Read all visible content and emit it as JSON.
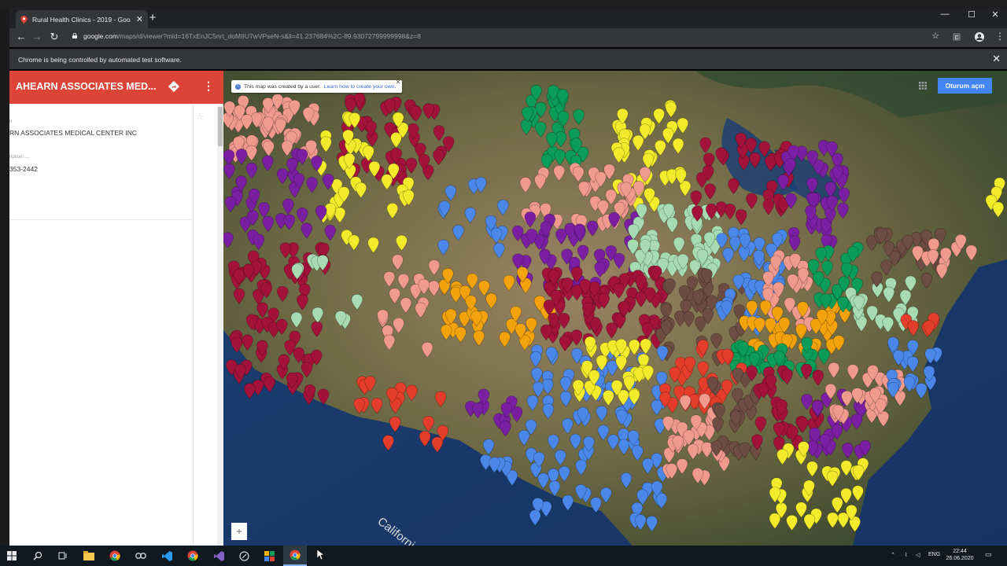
{
  "browser": {
    "tab_title": "Rural Health Clinics - 2019 - Goo",
    "url_host": "google.com",
    "url_path": "/maps/d/viewer?mid=16TxEnJC5nrt_doMIIU7wVPseN-s&ll=41.237684%2C-89.93072799999998&z=8",
    "infobar_message": "Chrome is being controlled by automated test software.",
    "new_tab_label": "+"
  },
  "sidepanel": {
    "title": "AHEARN ASSOCIATES MED...",
    "field1_label": "n",
    "field1_value": "RN ASSOCIATES MEDICAL CENTER INC",
    "field2_label": "ription:.....",
    "field2_value": "353-2442"
  },
  "map": {
    "notice_text": "This map was created by a user.",
    "notice_link": "Learn how to create your own.",
    "signin_label": "Oturum açın",
    "zoom_in": "+",
    "place_label": "California",
    "marker_colors": {
      "crimson": "#a3123a",
      "salmon": "#f09a8e",
      "yellow": "#f2ea2a",
      "green": "#0b9d58",
      "purple": "#7b1fa2",
      "blue": "#4a87e8",
      "mint": "#a7dcb2",
      "brown": "#6d4c41",
      "orange": "#f2a20d",
      "red": "#e53d2c",
      "darkgreen": "#12873a"
    }
  },
  "taskbar": {
    "lang": "ENG",
    "time": "22:44",
    "date": "26.06.2020"
  }
}
